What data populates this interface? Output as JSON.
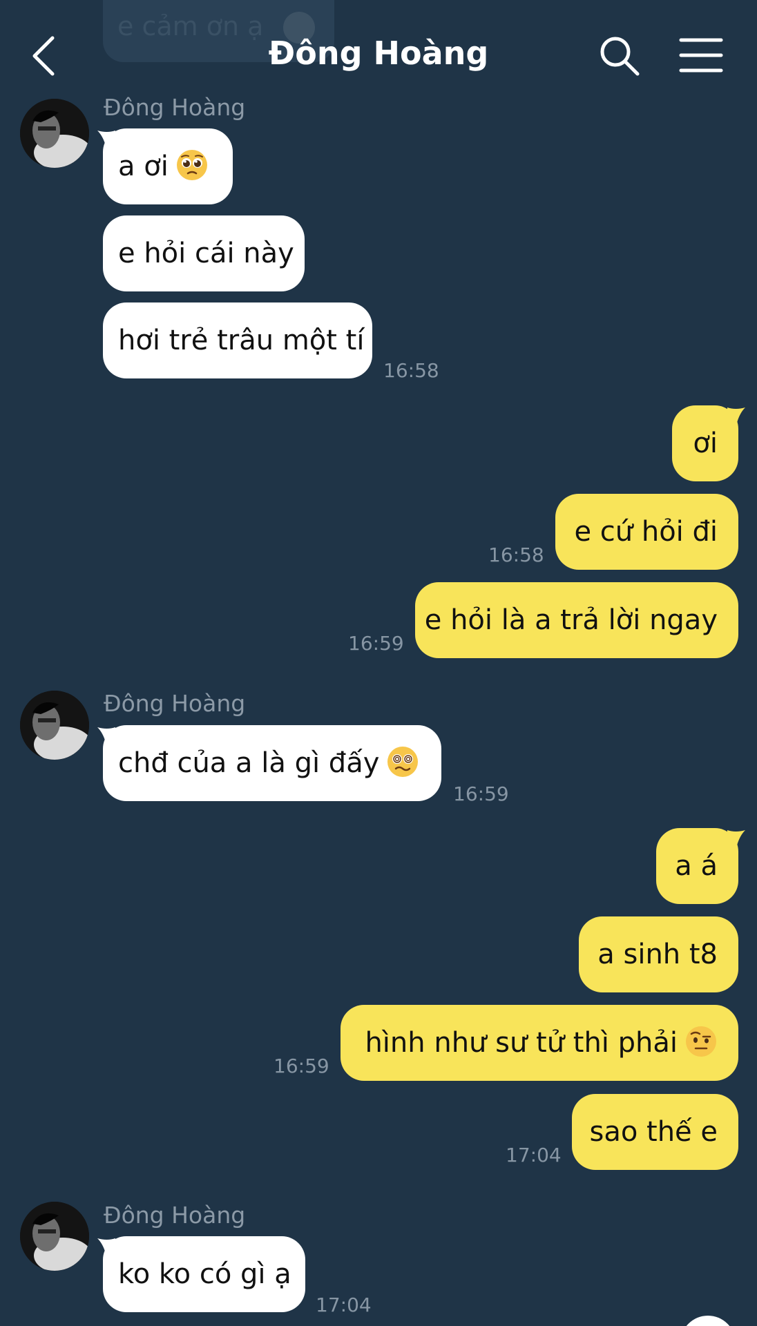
{
  "header": {
    "title": "Đông Hoàng"
  },
  "previous_message": {
    "text": "e cảm ơn ạ",
    "emoji": "relieved-face-emoji"
  },
  "messages": {
    "g1": {
      "sender": "Đông Hoàng",
      "m1": "a ơi",
      "m1_emoji": "pleading-face-emoji",
      "m2": "e hỏi cái này",
      "m3": "hơi trẻ trâu một tí",
      "time": "16:58"
    },
    "o1": {
      "m1": "ơi",
      "m2": "e cứ hỏi đi",
      "time1": "16:58",
      "m3": "e hỏi là a trả lời ngay",
      "time2": "16:59"
    },
    "g2": {
      "sender": "Đông Hoàng",
      "m1": "chđ của a là gì đấy",
      "m1_emoji": "face-with-spiral-eyes-emoji",
      "time": "16:59"
    },
    "o2": {
      "m1": "a á",
      "m2": "a sinh t8",
      "m3": "hình như sư tử thì phải",
      "m3_emoji": "face-with-raised-eyebrow-emoji",
      "time1": "16:59",
      "m4": "sao thế e",
      "time2": "17:04"
    },
    "g3": {
      "sender": "Đông Hoàng",
      "m1": "ko ko có gì ạ",
      "time": "17:04"
    }
  },
  "colors": {
    "background": "#1f3447",
    "incoming_bubble": "#ffffff",
    "outgoing_bubble": "#f8e45a",
    "timestamp": "#8796a4",
    "sender_name": "#8c9aa7"
  }
}
